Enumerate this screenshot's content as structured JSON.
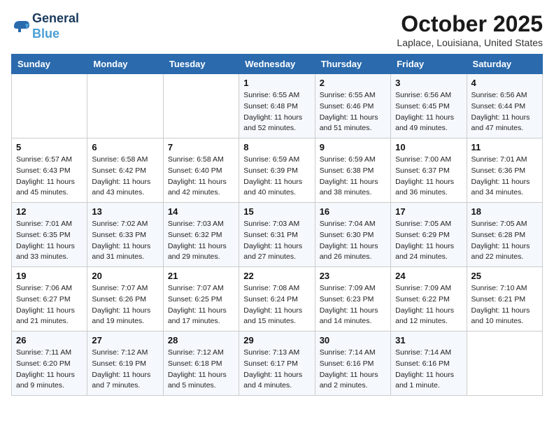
{
  "header": {
    "logo_line1": "General",
    "logo_line2": "Blue",
    "month": "October 2025",
    "location": "Laplace, Louisiana, United States"
  },
  "weekdays": [
    "Sunday",
    "Monday",
    "Tuesday",
    "Wednesday",
    "Thursday",
    "Friday",
    "Saturday"
  ],
  "weeks": [
    [
      {
        "day": "",
        "info": ""
      },
      {
        "day": "",
        "info": ""
      },
      {
        "day": "",
        "info": ""
      },
      {
        "day": "1",
        "info": "Sunrise: 6:55 AM\nSunset: 6:48 PM\nDaylight: 11 hours\nand 52 minutes."
      },
      {
        "day": "2",
        "info": "Sunrise: 6:55 AM\nSunset: 6:46 PM\nDaylight: 11 hours\nand 51 minutes."
      },
      {
        "day": "3",
        "info": "Sunrise: 6:56 AM\nSunset: 6:45 PM\nDaylight: 11 hours\nand 49 minutes."
      },
      {
        "day": "4",
        "info": "Sunrise: 6:56 AM\nSunset: 6:44 PM\nDaylight: 11 hours\nand 47 minutes."
      }
    ],
    [
      {
        "day": "5",
        "info": "Sunrise: 6:57 AM\nSunset: 6:43 PM\nDaylight: 11 hours\nand 45 minutes."
      },
      {
        "day": "6",
        "info": "Sunrise: 6:58 AM\nSunset: 6:42 PM\nDaylight: 11 hours\nand 43 minutes."
      },
      {
        "day": "7",
        "info": "Sunrise: 6:58 AM\nSunset: 6:40 PM\nDaylight: 11 hours\nand 42 minutes."
      },
      {
        "day": "8",
        "info": "Sunrise: 6:59 AM\nSunset: 6:39 PM\nDaylight: 11 hours\nand 40 minutes."
      },
      {
        "day": "9",
        "info": "Sunrise: 6:59 AM\nSunset: 6:38 PM\nDaylight: 11 hours\nand 38 minutes."
      },
      {
        "day": "10",
        "info": "Sunrise: 7:00 AM\nSunset: 6:37 PM\nDaylight: 11 hours\nand 36 minutes."
      },
      {
        "day": "11",
        "info": "Sunrise: 7:01 AM\nSunset: 6:36 PM\nDaylight: 11 hours\nand 34 minutes."
      }
    ],
    [
      {
        "day": "12",
        "info": "Sunrise: 7:01 AM\nSunset: 6:35 PM\nDaylight: 11 hours\nand 33 minutes."
      },
      {
        "day": "13",
        "info": "Sunrise: 7:02 AM\nSunset: 6:33 PM\nDaylight: 11 hours\nand 31 minutes."
      },
      {
        "day": "14",
        "info": "Sunrise: 7:03 AM\nSunset: 6:32 PM\nDaylight: 11 hours\nand 29 minutes."
      },
      {
        "day": "15",
        "info": "Sunrise: 7:03 AM\nSunset: 6:31 PM\nDaylight: 11 hours\nand 27 minutes."
      },
      {
        "day": "16",
        "info": "Sunrise: 7:04 AM\nSunset: 6:30 PM\nDaylight: 11 hours\nand 26 minutes."
      },
      {
        "day": "17",
        "info": "Sunrise: 7:05 AM\nSunset: 6:29 PM\nDaylight: 11 hours\nand 24 minutes."
      },
      {
        "day": "18",
        "info": "Sunrise: 7:05 AM\nSunset: 6:28 PM\nDaylight: 11 hours\nand 22 minutes."
      }
    ],
    [
      {
        "day": "19",
        "info": "Sunrise: 7:06 AM\nSunset: 6:27 PM\nDaylight: 11 hours\nand 21 minutes."
      },
      {
        "day": "20",
        "info": "Sunrise: 7:07 AM\nSunset: 6:26 PM\nDaylight: 11 hours\nand 19 minutes."
      },
      {
        "day": "21",
        "info": "Sunrise: 7:07 AM\nSunset: 6:25 PM\nDaylight: 11 hours\nand 17 minutes."
      },
      {
        "day": "22",
        "info": "Sunrise: 7:08 AM\nSunset: 6:24 PM\nDaylight: 11 hours\nand 15 minutes."
      },
      {
        "day": "23",
        "info": "Sunrise: 7:09 AM\nSunset: 6:23 PM\nDaylight: 11 hours\nand 14 minutes."
      },
      {
        "day": "24",
        "info": "Sunrise: 7:09 AM\nSunset: 6:22 PM\nDaylight: 11 hours\nand 12 minutes."
      },
      {
        "day": "25",
        "info": "Sunrise: 7:10 AM\nSunset: 6:21 PM\nDaylight: 11 hours\nand 10 minutes."
      }
    ],
    [
      {
        "day": "26",
        "info": "Sunrise: 7:11 AM\nSunset: 6:20 PM\nDaylight: 11 hours\nand 9 minutes."
      },
      {
        "day": "27",
        "info": "Sunrise: 7:12 AM\nSunset: 6:19 PM\nDaylight: 11 hours\nand 7 minutes."
      },
      {
        "day": "28",
        "info": "Sunrise: 7:12 AM\nSunset: 6:18 PM\nDaylight: 11 hours\nand 5 minutes."
      },
      {
        "day": "29",
        "info": "Sunrise: 7:13 AM\nSunset: 6:17 PM\nDaylight: 11 hours\nand 4 minutes."
      },
      {
        "day": "30",
        "info": "Sunrise: 7:14 AM\nSunset: 6:16 PM\nDaylight: 11 hours\nand 2 minutes."
      },
      {
        "day": "31",
        "info": "Sunrise: 7:14 AM\nSunset: 6:16 PM\nDaylight: 11 hours\nand 1 minute."
      },
      {
        "day": "",
        "info": ""
      }
    ]
  ]
}
